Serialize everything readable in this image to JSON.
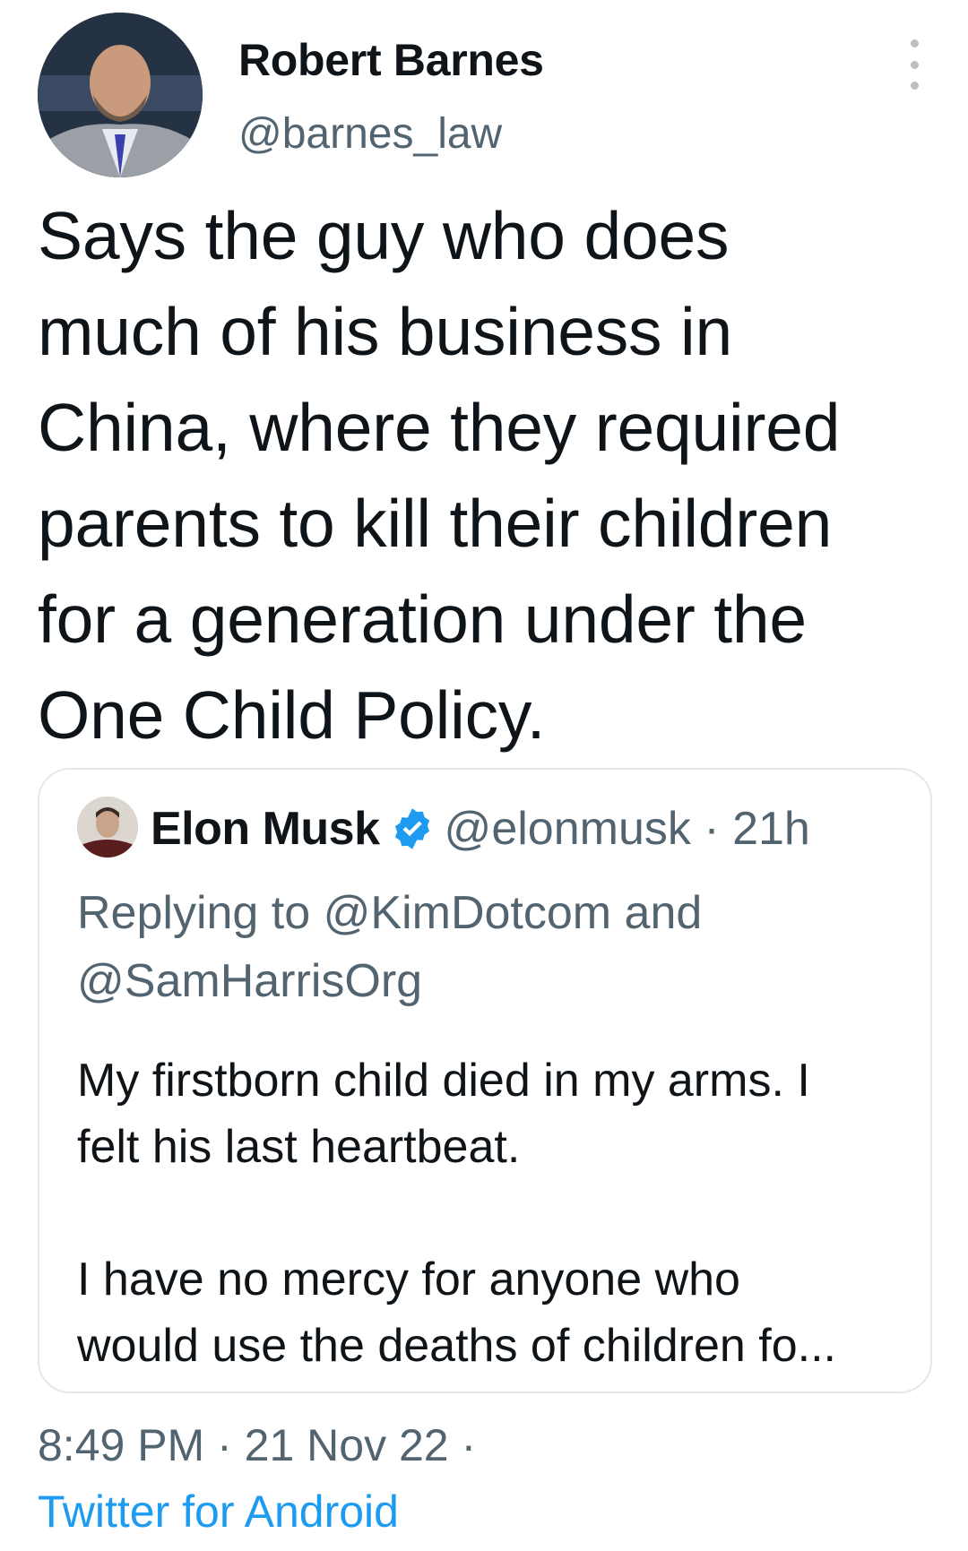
{
  "author": {
    "display_name": "Robert Barnes",
    "handle": "@barnes_law",
    "avatar_icon": "user-photo-avatar"
  },
  "tweet": {
    "text": "Says the guy who does\nmuch of his business in\nChina, where they required\nparents to kill their children\nfor a generation under the\nOne Child Policy."
  },
  "quoted": {
    "display_name": "Elon Musk",
    "verified_icon": "verified-badge-icon",
    "handle": "@elonmusk",
    "time": "21h",
    "meta": "@elonmusk · 21h",
    "replying_to": "Replying to @KimDotcom and @SamHarrisOrg",
    "text": "My firstborn child died in my arms. I\nfelt his last heartbeat.\n\nI have no mercy for anyone who\nwould use the deaths of children fo..."
  },
  "footer": {
    "timestamp": "8:49 PM · 21 Nov 22 ·",
    "source": "Twitter for Android"
  },
  "colors": {
    "text_primary": "#0f1419",
    "text_secondary": "#536471",
    "link_blue": "#1d9bf0",
    "border": "#e3e8ec"
  }
}
